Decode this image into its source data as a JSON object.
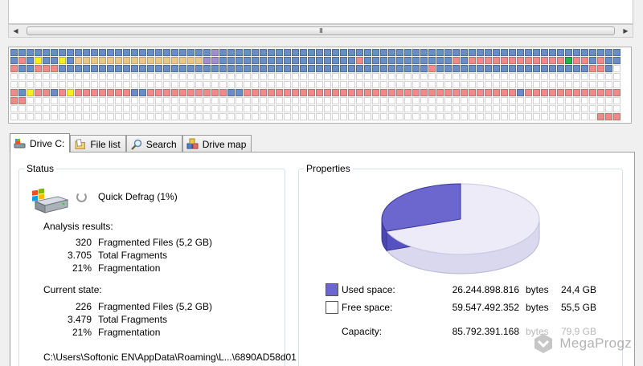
{
  "scrollbar": {
    "thumb_grip": "III"
  },
  "drive_map": {
    "cols": 76,
    "rows": [
      "BBBBBBBBBBBBBBBBBBBBBBBBBPBBBBBBBBBBBBBBBBBBBBBBBBBBBBBBBBBBBBBBBBBBBBBBBBBB",
      "BRBYBBYBTTTTTTTTTTTTTTTTPPBBBBBBBBBBBBBBBBBRBBBBBBBBBBBRBRRRRRRRRRRRRGRRBRBB",
      "RBBRRRBBBBBBBBBBBBBBBBBBBBBBBBBBBBBBBBBBBBBBBBBBBBBBRBBBBBBBBBBBBBBBBBBBRRBE",
      "EEEEEEEEEEEEEEEEEEEEEEEEEEEEEEEEEEEEEEEEEEEEEEEEEEEEEEEEEEEEEEEEEEEEEEEEEEEE",
      "EEEEEEEEEEEEEEEEEEEEEEEEEEEEEEEEEEEEEEEEEEEEEEEEEEEEEEEEEEEEEEEEEEEEEEEEEEEE",
      "RBYRRBRYRRRRRRRBBRRRRRRRRRRBBRRRRRRRRRRRRRRRRRRRRRRRRRRRRRRRRRRBRRRRRRRRRRRR",
      "RREEEEEEEEEEEEEEEEEEEEEEEEEEEEEEEEEEEEEEEEEEEEEEEEEEEEEEEEEEEEEEEEEEEEEEEEEE",
      "EEEEEEEEEEEEEEEEEEEEEEEEEEEEEEEEEEEEEEEEEEEEEEEEEEEEEEEEEEEEEEEEEEEEEEEEEEEE",
      "EEEEEEEEEEEEEEEEEEEEEEEEEEEEEEEEEEEEEEEEEEEEEEEEEEEEEEEEEEEEEEEEEEEEEEEEERRR"
    ],
    "colors": {
      "blue": "#6a8dc6",
      "red": "#ee8a8a",
      "yellow": "#f6ef1e",
      "tan": "#e7c889",
      "purple": "#a08fd0",
      "green": "#1fb64a",
      "empty": "#ffffff"
    }
  },
  "tabs": [
    {
      "label": "Drive C:",
      "icon": "drive-icon",
      "active": true
    },
    {
      "label": "File list",
      "icon": "folder-icon",
      "active": false
    },
    {
      "label": "Search",
      "icon": "search-icon",
      "active": false
    },
    {
      "label": "Drive map",
      "icon": "drive-map-icon",
      "active": false
    }
  ],
  "status": {
    "title": "Status",
    "operation": "Quick Defrag (1%)",
    "analysis": {
      "label": "Analysis results:",
      "rows": [
        {
          "value": "320",
          "desc": "Fragmented Files (5,2 GB)"
        },
        {
          "value": "3.705",
          "desc": "Total Fragments"
        },
        {
          "value": "21%",
          "desc": "Fragmentation"
        }
      ]
    },
    "current": {
      "label": "Current state:",
      "rows": [
        {
          "value": "226",
          "desc": "Fragmented Files (5,2 GB)"
        },
        {
          "value": "3.479",
          "desc": "Total Fragments"
        },
        {
          "value": "21%",
          "desc": "Fragmentation"
        }
      ]
    },
    "path": "C:\\Users\\Softonic EN\\AppData\\Roaming\\L...\\6890AD58d01"
  },
  "properties": {
    "title": "Properties",
    "used_fraction": 0.306,
    "used_color": "#6b67cf",
    "free_color": "#ecebf7",
    "used": {
      "label": "Used space:",
      "bytes": "26.244.898.816",
      "unit": "bytes",
      "size": "24,4 GB"
    },
    "free": {
      "label": "Free space:",
      "bytes": "59.547.492.352",
      "unit": "bytes",
      "size": "55,5 GB"
    },
    "capacity": {
      "label": "Capacity:",
      "bytes": "85.792.391.168",
      "unit": "bytes",
      "size": "79,9 GB"
    }
  },
  "watermark": {
    "text": "MegaProgz"
  }
}
